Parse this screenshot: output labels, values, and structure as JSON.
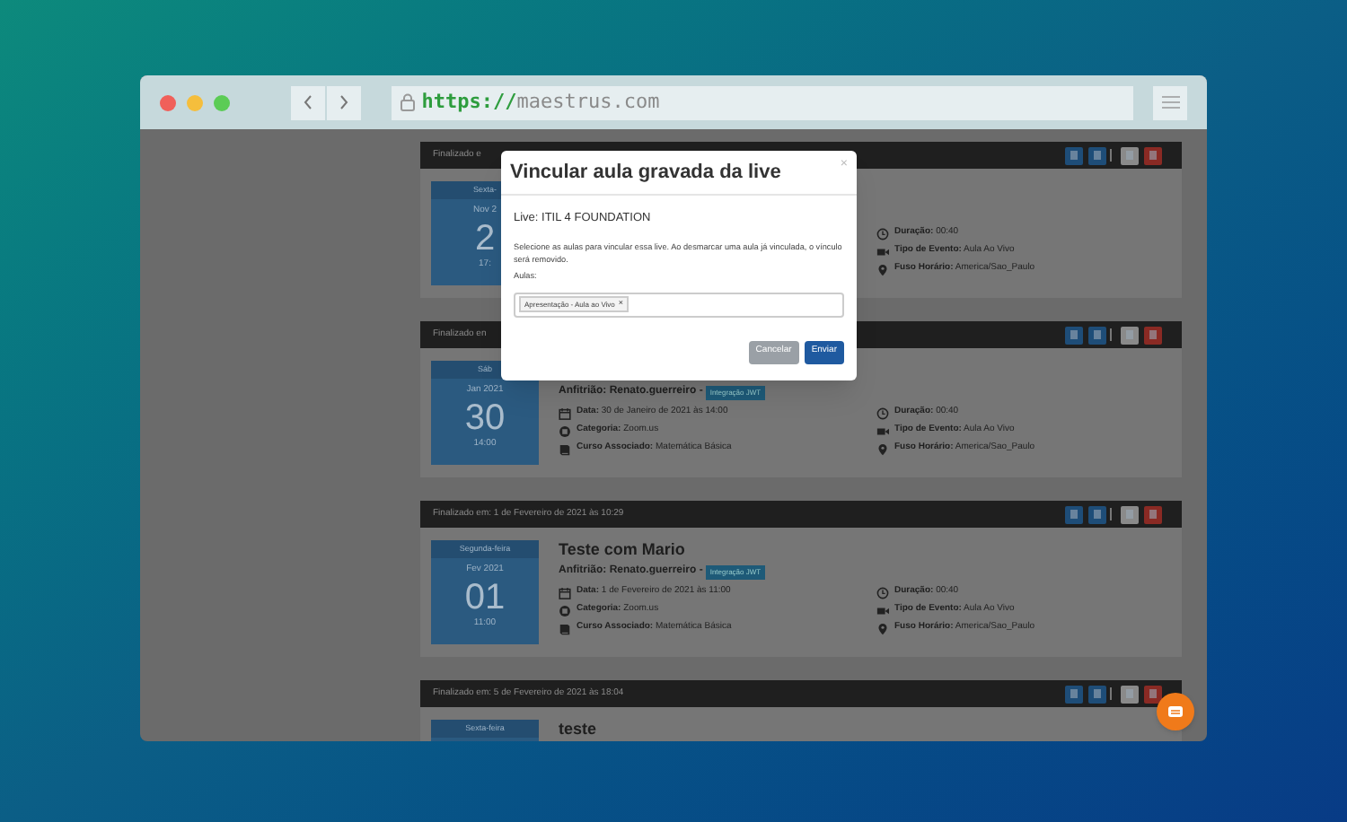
{
  "browser": {
    "url_scheme": "https://",
    "url_host": "maestrus.com"
  },
  "events": [
    {
      "header": "Finalizado e",
      "weekday": "Sexta-",
      "month": "Nov 2",
      "day": "2",
      "time": "17:",
      "details_right": [
        {
          "kind": "clock",
          "label": "Duração:",
          "value": "00:40"
        },
        {
          "kind": "video",
          "label": "Tipo de Evento:",
          "value": "Aula Ao Vivo"
        },
        {
          "kind": "pin",
          "label": "Fuso Horário:",
          "value": "America/Sao_Paulo"
        }
      ]
    },
    {
      "header": "Finalizado en",
      "weekday": "Sáb",
      "month": "Jan 2021",
      "day": "30",
      "time": "14:00",
      "host": "Anfitrião: Renato.guerreiro -",
      "badge": "Integração JWT",
      "details_left": [
        {
          "kind": "calendar",
          "label": "Data:",
          "value": "30 de Janeiro de 2021 às 14:00"
        },
        {
          "kind": "category",
          "label": "Categoria:",
          "value": "Zoom.us"
        },
        {
          "kind": "book",
          "label": "Curso Associado:",
          "value": "Matemática Básica"
        }
      ],
      "details_right": [
        {
          "kind": "clock",
          "label": "Duração:",
          "value": "00:40"
        },
        {
          "kind": "video",
          "label": "Tipo de Evento:",
          "value": "Aula Ao Vivo"
        },
        {
          "kind": "pin",
          "label": "Fuso Horário:",
          "value": "America/Sao_Paulo"
        }
      ]
    },
    {
      "header": "Finalizado em: 1 de Fevereiro de 2021 às 10:29",
      "weekday": "Segunda-feira",
      "month": "Fev 2021",
      "day": "01",
      "time": "11:00",
      "title": "Teste com Mario",
      "host": "Anfitrião: Renato.guerreiro -",
      "badge": "Integração JWT",
      "details_left": [
        {
          "kind": "calendar",
          "label": "Data:",
          "value": "1 de Fevereiro de 2021 às 11:00"
        },
        {
          "kind": "category",
          "label": "Categoria:",
          "value": "Zoom.us"
        },
        {
          "kind": "book",
          "label": "Curso Associado:",
          "value": "Matemática Básica"
        }
      ],
      "details_right": [
        {
          "kind": "clock",
          "label": "Duração:",
          "value": "00:40"
        },
        {
          "kind": "video",
          "label": "Tipo de Evento:",
          "value": "Aula Ao Vivo"
        },
        {
          "kind": "pin",
          "label": "Fuso Horário:",
          "value": "America/Sao_Paulo"
        }
      ]
    },
    {
      "header": "Finalizado em: 5 de Fevereiro de 2021 às 18:04",
      "weekday": "Sexta-feira",
      "title": "teste"
    }
  ],
  "modal": {
    "title": "Vincular aula gravada da live",
    "close": "×",
    "live": "Live: ITIL 4 FOUNDATION",
    "description": "Selecione as aulas para vincular essa live. Ao desmarcar uma aula já vinculada, o vínculo será removido.",
    "field_label": "Aulas:",
    "tags": [
      {
        "label": "Apresentação - Aula ao Vivo",
        "remove": "×"
      }
    ],
    "buttons": [
      {
        "label": "Cancelar",
        "kind": "secondary"
      },
      {
        "label": "Enviar",
        "kind": "primary"
      }
    ]
  }
}
